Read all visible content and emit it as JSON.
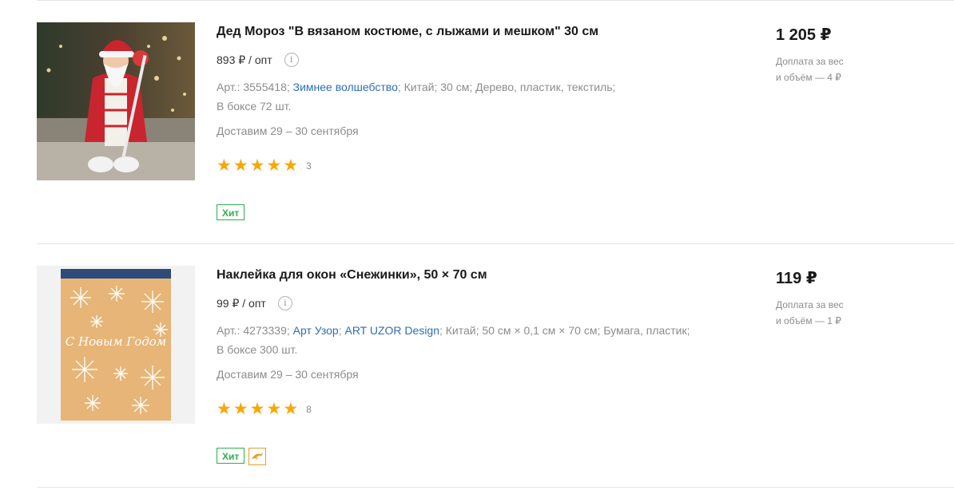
{
  "products": [
    {
      "title": "Дед Мороз \"В вязаном костюме, с лыжами и мешком\" 30 см",
      "opt_price": "893 ₽ / опт",
      "info_icon": "info-icon",
      "article_label": "Арт.: 3555418;",
      "brand_link": "Зимнее волшебство",
      "brand_link_2": "",
      "details": "; Китай; 30 см; Дерево, пластик, текстиль;",
      "box_qty": "В боксе 72 шт.",
      "delivery": "Доставим 29 – 30 сентября",
      "rating_stars": 5,
      "rating_count": "3",
      "badge_hit": "Хит",
      "price": "1 205 ₽",
      "surcharge_line1": "Доплата за вес",
      "surcharge_line2": "и объём — 4 ₽"
    },
    {
      "title": "Наклейка для окон «Снежинки», 50 × 70 см",
      "opt_price": "99 ₽ / опт",
      "info_icon": "info-icon",
      "article_label": "Арт.: 4273339;",
      "brand_link": "Арт Узор",
      "brand_link_2": "ART UZOR Design",
      "details": "; Китай; 50 см × 0,1 см × 70 см; Бумага, пластик;",
      "box_qty": "В боксе 300 шт.",
      "delivery": "Доставим 29 – 30 сентября",
      "rating_stars": 5,
      "rating_count": "8",
      "badge_hit": "Хит",
      "badge_extra_icon": "dolphin-icon",
      "image_text": "С Новым Годом",
      "price": "119 ₽",
      "surcharge_line1": "Доплата за вес",
      "surcharge_line2": "и объём — 1 ₽"
    }
  ],
  "colors": {
    "link": "#2f6db5",
    "hit_badge": "#2fae4d",
    "star": "#f7a707",
    "muted_text": "#8c8c8c"
  }
}
